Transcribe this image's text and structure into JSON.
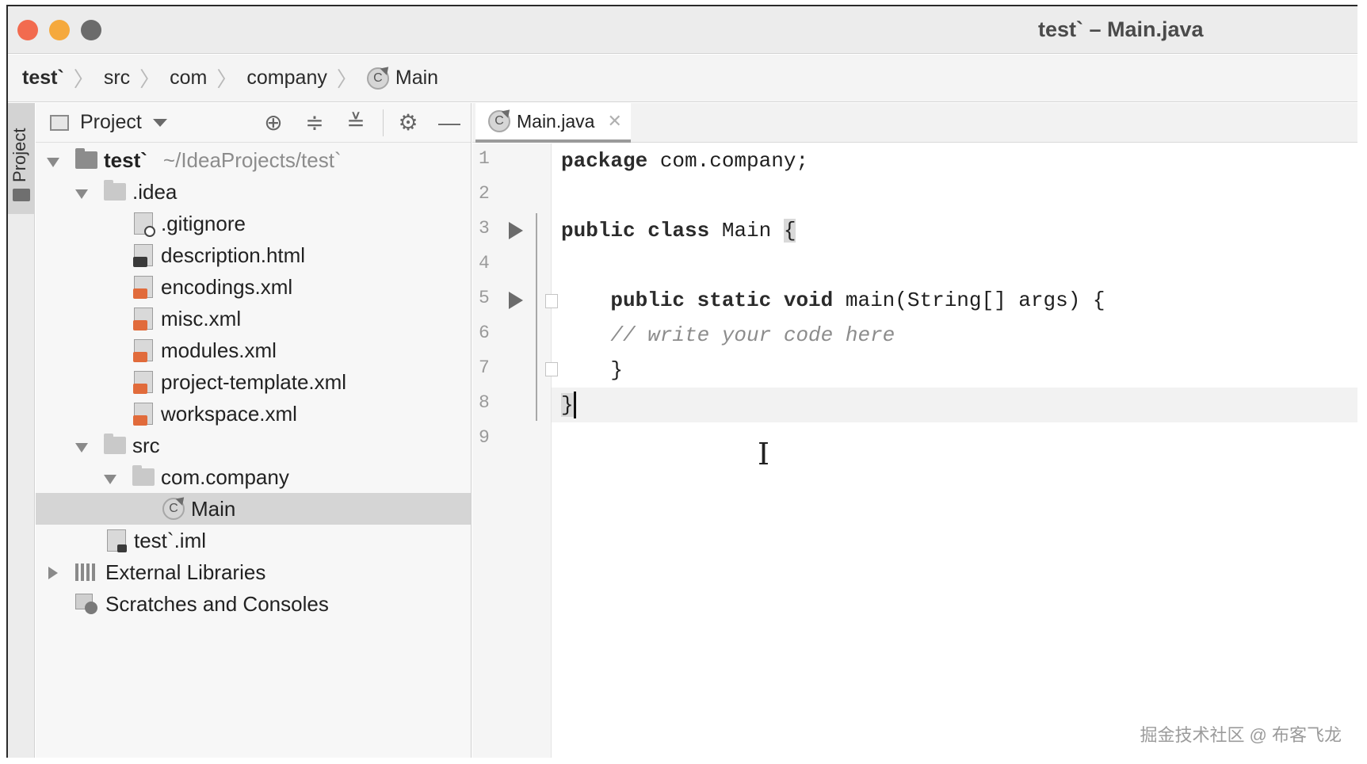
{
  "window": {
    "title": "test` – Main.java"
  },
  "breadcrumb": {
    "items": [
      "test`",
      "src",
      "com",
      "company",
      "Main"
    ]
  },
  "sidebar_strip": {
    "label": "Project"
  },
  "project_panel": {
    "title": "Project",
    "tree": [
      {
        "label": "test`",
        "hint": "~/IdeaProjects/test`"
      },
      {
        "label": ".idea"
      },
      {
        "label": ".gitignore"
      },
      {
        "label": "description.html"
      },
      {
        "label": "encodings.xml"
      },
      {
        "label": "misc.xml"
      },
      {
        "label": "modules.xml"
      },
      {
        "label": "project-template.xml"
      },
      {
        "label": "workspace.xml"
      },
      {
        "label": "src"
      },
      {
        "label": "com.company"
      },
      {
        "label": "Main"
      },
      {
        "label": "test`.iml"
      },
      {
        "label": "External Libraries"
      },
      {
        "label": "Scratches and Consoles"
      }
    ]
  },
  "editor": {
    "tab_label": "Main.java",
    "line_numbers": [
      "1",
      "2",
      "3",
      "4",
      "5",
      "6",
      "7",
      "8",
      "9"
    ],
    "code": {
      "l1_kw": "package",
      "l1_rest": " com.company;",
      "l3_kw": "public class",
      "l3_rest": " Main ",
      "l3_brace": "{",
      "l5_kw": "    public static void",
      "l5_rest": " main(String[] args) {",
      "l6_comment": "    // write your code here",
      "l7": "    }",
      "l8": "}"
    }
  },
  "watermark": "掘金技术社区 @ 布客飞龙"
}
